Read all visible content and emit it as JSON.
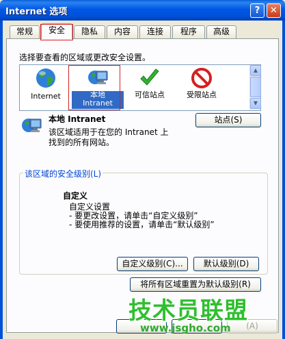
{
  "window": {
    "title": "Internet 选项",
    "help_glyph": "?",
    "close_glyph": "✕"
  },
  "tabs": [
    {
      "label": "常规",
      "active": false
    },
    {
      "label": "安全",
      "active": true
    },
    {
      "label": "隐私",
      "active": false
    },
    {
      "label": "内容",
      "active": false
    },
    {
      "label": "连接",
      "active": false
    },
    {
      "label": "程序",
      "active": false
    },
    {
      "label": "高级",
      "active": false
    }
  ],
  "security": {
    "select_zone_prompt": "选择要查看的区域或更改安全设置。",
    "zones": [
      {
        "name": "Internet",
        "icon": "globe-icon",
        "selected": false
      },
      {
        "name": "本地\nIntranet",
        "icon": "local-intranet-icon",
        "selected": true
      },
      {
        "name": "可信站点",
        "icon": "checkmark-icon",
        "selected": false
      },
      {
        "name": "受限站点",
        "icon": "restricted-icon",
        "selected": false
      }
    ],
    "zone_info": {
      "title": "本地 Intranet",
      "description_line1": "该区域适用于在您的 Intranet 上",
      "description_line2": "找到的所有网站。",
      "sites_button": "站点(S)"
    },
    "level_group": {
      "title": "该区域的安全级别(L)",
      "level_name": "自定义",
      "line1": "自定义设置",
      "line2": "- 要更改设置，请单击“自定义级别”",
      "line3": "- 要使用推荐的设置，请单击“默认级别”",
      "custom_button": "自定义级别(C)...",
      "default_button": "默认级别(D)"
    },
    "reset_all_button": "将所有区域重置为默认级别(R)",
    "bottom_partial_button": "(A)"
  },
  "watermark": {
    "text": "技术员联盟",
    "url": "www.jsgho.com"
  },
  "colors": {
    "title_bar": "#0054e3",
    "selection": "#316ac5",
    "highlight_box": "#d42020",
    "group_title": "#0046d5",
    "watermark": "#2fbf2f"
  }
}
